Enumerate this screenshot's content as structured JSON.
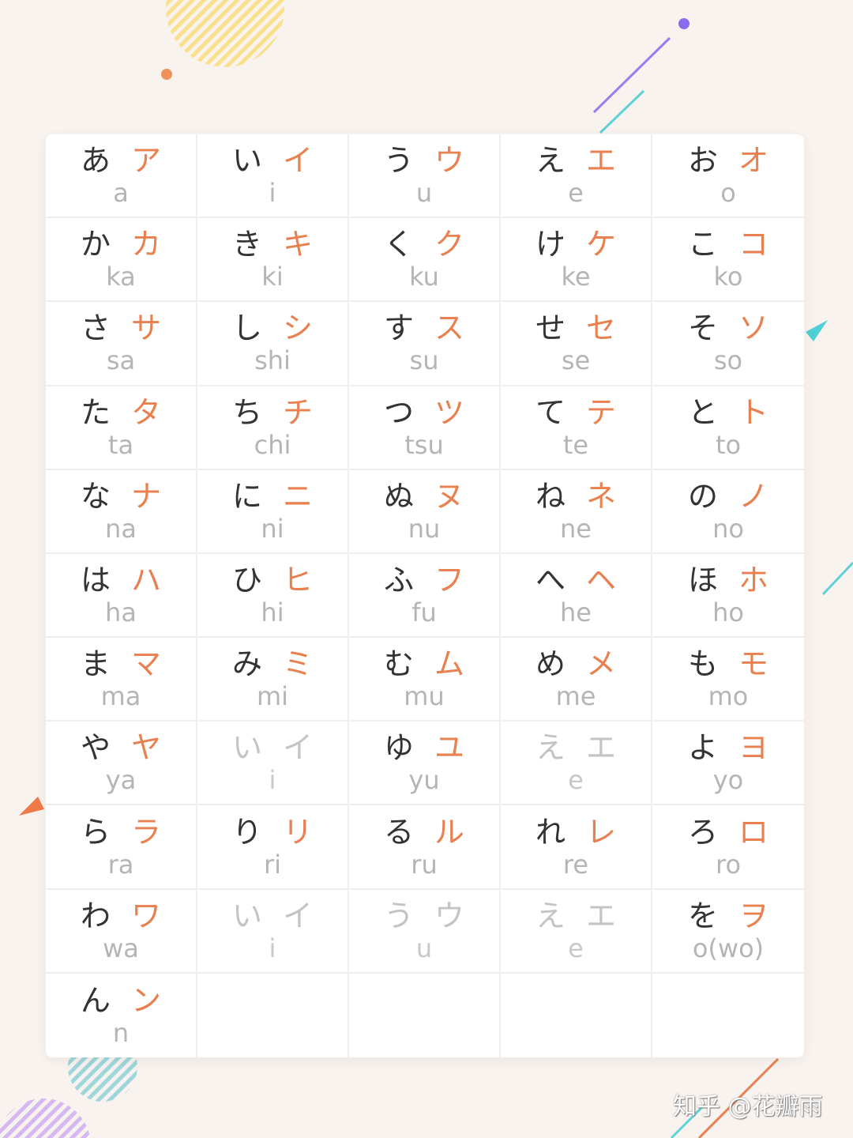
{
  "colors": {
    "hiragana": "#333333",
    "katakana": "#e8804f",
    "romaji": "#b5b5b5",
    "background": "#f9f3ef",
    "dim": "#c4c4c4"
  },
  "rows": [
    [
      {
        "h": "あ",
        "k": "ア",
        "r": "a"
      },
      {
        "h": "い",
        "k": "イ",
        "r": "i"
      },
      {
        "h": "う",
        "k": "ウ",
        "r": "u"
      },
      {
        "h": "え",
        "k": "エ",
        "r": "e"
      },
      {
        "h": "お",
        "k": "オ",
        "r": "o"
      }
    ],
    [
      {
        "h": "か",
        "k": "カ",
        "r": "ka"
      },
      {
        "h": "き",
        "k": "キ",
        "r": "ki"
      },
      {
        "h": "く",
        "k": "ク",
        "r": "ku"
      },
      {
        "h": "け",
        "k": "ケ",
        "r": "ke"
      },
      {
        "h": "こ",
        "k": "コ",
        "r": "ko"
      }
    ],
    [
      {
        "h": "さ",
        "k": "サ",
        "r": "sa"
      },
      {
        "h": "し",
        "k": "シ",
        "r": "shi"
      },
      {
        "h": "す",
        "k": "ス",
        "r": "su"
      },
      {
        "h": "せ",
        "k": "セ",
        "r": "se"
      },
      {
        "h": "そ",
        "k": "ソ",
        "r": "so"
      }
    ],
    [
      {
        "h": "た",
        "k": "タ",
        "r": "ta"
      },
      {
        "h": "ち",
        "k": "チ",
        "r": "chi"
      },
      {
        "h": "つ",
        "k": "ツ",
        "r": "tsu"
      },
      {
        "h": "て",
        "k": "テ",
        "r": "te"
      },
      {
        "h": "と",
        "k": "ト",
        "r": "to"
      }
    ],
    [
      {
        "h": "な",
        "k": "ナ",
        "r": "na"
      },
      {
        "h": "に",
        "k": "ニ",
        "r": "ni"
      },
      {
        "h": "ぬ",
        "k": "ヌ",
        "r": "nu"
      },
      {
        "h": "ね",
        "k": "ネ",
        "r": "ne"
      },
      {
        "h": "の",
        "k": "ノ",
        "r": "no"
      }
    ],
    [
      {
        "h": "は",
        "k": "ハ",
        "r": "ha"
      },
      {
        "h": "ひ",
        "k": "ヒ",
        "r": "hi"
      },
      {
        "h": "ふ",
        "k": "フ",
        "r": "fu"
      },
      {
        "h": "へ",
        "k": "ヘ",
        "r": "he"
      },
      {
        "h": "ほ",
        "k": "ホ",
        "r": "ho"
      }
    ],
    [
      {
        "h": "ま",
        "k": "マ",
        "r": "ma"
      },
      {
        "h": "み",
        "k": "ミ",
        "r": "mi"
      },
      {
        "h": "む",
        "k": "ム",
        "r": "mu"
      },
      {
        "h": "め",
        "k": "メ",
        "r": "me"
      },
      {
        "h": "も",
        "k": "モ",
        "r": "mo"
      }
    ],
    [
      {
        "h": "や",
        "k": "ヤ",
        "r": "ya"
      },
      {
        "h": "い",
        "k": "イ",
        "r": "i",
        "dim": true
      },
      {
        "h": "ゆ",
        "k": "ユ",
        "r": "yu"
      },
      {
        "h": "え",
        "k": "エ",
        "r": "e",
        "dim": true
      },
      {
        "h": "よ",
        "k": "ヨ",
        "r": "yo"
      }
    ],
    [
      {
        "h": "ら",
        "k": "ラ",
        "r": "ra"
      },
      {
        "h": "り",
        "k": "リ",
        "r": "ri"
      },
      {
        "h": "る",
        "k": "ル",
        "r": "ru"
      },
      {
        "h": "れ",
        "k": "レ",
        "r": "re"
      },
      {
        "h": "ろ",
        "k": "ロ",
        "r": "ro"
      }
    ],
    [
      {
        "h": "わ",
        "k": "ワ",
        "r": "wa"
      },
      {
        "h": "い",
        "k": "イ",
        "r": "i",
        "dim": true
      },
      {
        "h": "う",
        "k": "ウ",
        "r": "u",
        "dim": true
      },
      {
        "h": "え",
        "k": "エ",
        "r": "e",
        "dim": true
      },
      {
        "h": "を",
        "k": "ヲ",
        "r": "o(wo)"
      }
    ],
    [
      {
        "h": "ん",
        "k": "ン",
        "r": "n"
      },
      null,
      null,
      null,
      null
    ]
  ],
  "watermark": "知乎 @花瓣雨"
}
